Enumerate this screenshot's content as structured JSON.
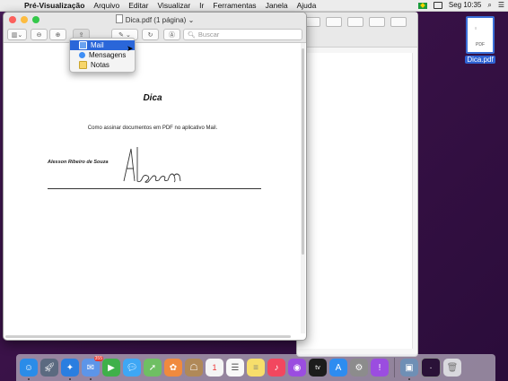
{
  "menubar": {
    "app": "Pré-Visualização",
    "items": [
      "Arquivo",
      "Editar",
      "Visualizar",
      "Ir",
      "Ferramentas",
      "Janela",
      "Ajuda"
    ],
    "clock": "Seg 10:35"
  },
  "window": {
    "title": "Dica.pdf (1 página)",
    "search_placeholder": "Buscar"
  },
  "document": {
    "title": "Dica",
    "subtitle": "Como assinar documentos em PDF no aplicativo Mail.",
    "signer_name": "Alesson Ribeiro de Souza",
    "signature": "Alesson"
  },
  "share_menu": {
    "items": [
      {
        "label": "Mail",
        "icon": "mail-icon",
        "selected": true
      },
      {
        "label": "Mensagens",
        "icon": "messages-icon",
        "selected": false
      },
      {
        "label": "Notas",
        "icon": "notes-icon",
        "selected": false
      }
    ]
  },
  "desktop": {
    "file_label": "Dica.pdf",
    "file_type": "PDF"
  },
  "dock": {
    "apps": [
      {
        "name": "finder-icon",
        "color": "#2a8ce8"
      },
      {
        "name": "launchpad-icon",
        "color": "#5b6a80"
      },
      {
        "name": "safari-icon",
        "color": "#2a7ee0"
      },
      {
        "name": "mail-icon",
        "color": "#5d95e8",
        "badge": "355"
      },
      {
        "name": "facetime-icon",
        "color": "#3fb04a"
      },
      {
        "name": "messages-icon",
        "color": "#3ea7f5"
      },
      {
        "name": "maps-icon",
        "color": "#6fbf63"
      },
      {
        "name": "photos-icon",
        "color": "#f08a3e"
      },
      {
        "name": "contacts-icon",
        "color": "#b08958"
      },
      {
        "name": "calendar-icon",
        "color": "#f4f4f4"
      },
      {
        "name": "reminders-icon",
        "color": "#f8f8f8"
      },
      {
        "name": "notes-icon",
        "color": "#f7de6b"
      },
      {
        "name": "music-icon",
        "color": "#f2475f"
      },
      {
        "name": "podcasts-icon",
        "color": "#9b4de0"
      },
      {
        "name": "tv-icon",
        "color": "#1c1c1c"
      },
      {
        "name": "app-store-icon",
        "color": "#2e8cf0"
      },
      {
        "name": "system-preferences-icon",
        "color": "#8c8c8c"
      },
      {
        "name": "feedback-icon",
        "color": "#9b4de0"
      },
      {
        "name": "preview-icon",
        "color": "#6f8fb5"
      },
      {
        "name": "screenshot-thumb-icon",
        "color": "#2a1238"
      },
      {
        "name": "trash-icon",
        "color": "#d9d9de"
      }
    ],
    "calendar_day": "1",
    "tv_label": "tv"
  }
}
